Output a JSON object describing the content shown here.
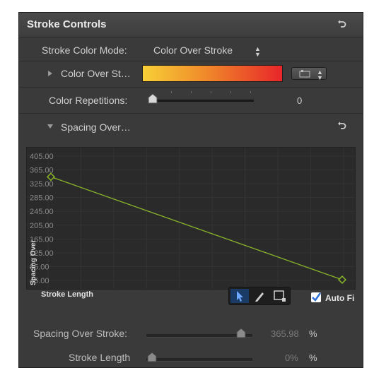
{
  "header": {
    "title": "Stroke Controls"
  },
  "stroke_color_mode": {
    "label": "Stroke Color Mode:",
    "value": "Color Over Stroke"
  },
  "color_over_stroke": {
    "label": "Color Over St…"
  },
  "color_repetitions": {
    "label": "Color Repetitions:",
    "value": "0"
  },
  "spacing_over": {
    "label": "Spacing Over…"
  },
  "graph": {
    "y_ticks": [
      "405.00",
      "365.00",
      "325.00",
      "285.00",
      "245.00",
      "205.00",
      "165.00",
      "125.00",
      "85.00",
      "45.00"
    ],
    "y_axis_label": "Spacing Over",
    "x_axis_label": "Stroke Length",
    "curve_color": "#8ab52a",
    "keyframe_start": {
      "x": 0,
      "y": 345
    },
    "keyframe_end": {
      "x": 1,
      "y": 47
    },
    "auto_fit_label": "Auto Fi"
  },
  "spacing_over_stroke": {
    "label": "Spacing Over Stroke:",
    "value": "365.98",
    "unit": "%"
  },
  "stroke_length": {
    "label": "Stroke Length",
    "value": "0%",
    "unit": "%"
  }
}
